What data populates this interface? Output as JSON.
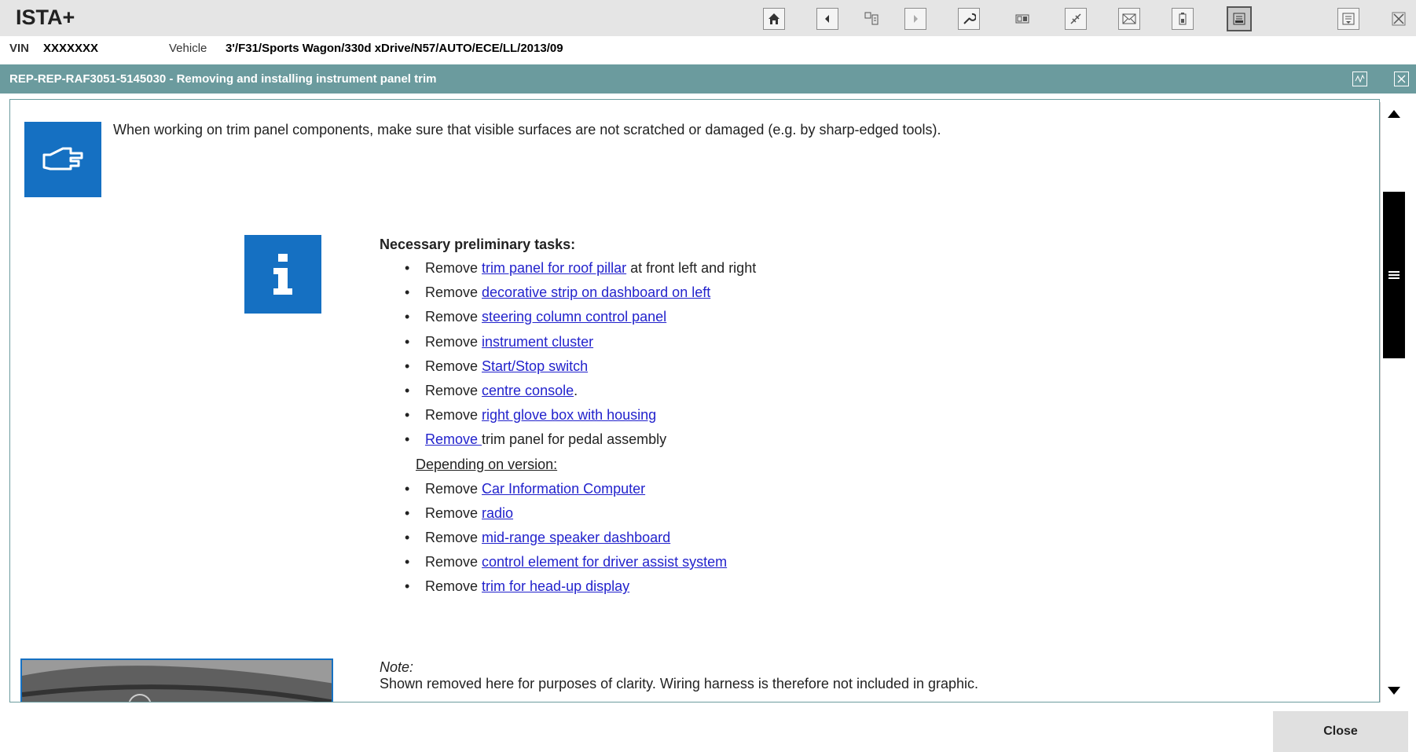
{
  "app": {
    "title": "ISTA+"
  },
  "vehicle": {
    "vin_label": "VIN",
    "vin": "XXXXXXX",
    "vehicle_label": "Vehicle",
    "vehicle": "3'/F31/Sports Wagon/330d xDrive/N57/AUTO/ECE/LL/2013/09"
  },
  "toolbar": {
    "icons": [
      "home-icon",
      "back-icon",
      "tree-icon",
      "forward-icon",
      "wrench-icon",
      "measure-icon",
      "connection-icon",
      "message-icon",
      "battery-icon",
      "document-view-icon",
      "menu-icon",
      "close-icon"
    ]
  },
  "document": {
    "title": "REP-REP-RAF3051-5145030 - Removing and installing instrument panel trim",
    "warning": "When working on trim panel components, make sure that visible surfaces are not scratched or damaged (e.g. by sharp-edged tools).",
    "tasks_heading": "Necessary preliminary tasks:",
    "tasks": [
      {
        "prefix": "Remove ",
        "link": "trim panel for roof pillar",
        "suffix": " at front left and right"
      },
      {
        "prefix": "Remove ",
        "link": "decorative strip on dashboard on left",
        "suffix": ""
      },
      {
        "prefix": "Remove ",
        "link": "steering column control panel",
        "suffix": ""
      },
      {
        "prefix": "Remove ",
        "link": "instrument cluster",
        "suffix": ""
      },
      {
        "prefix": "Remove ",
        "link": "Start/Stop switch",
        "suffix": ""
      },
      {
        "prefix": "Remove ",
        "link": "centre console",
        "suffix": "."
      },
      {
        "prefix": "Remove ",
        "link": "right glove box with housing",
        "suffix": ""
      },
      {
        "prefix": "",
        "link": "Remove ",
        "suffix": "trim panel for pedal assembly"
      }
    ],
    "version_heading": "Depending on version:",
    "version_tasks": [
      {
        "prefix": "Remove ",
        "link": "Car Information Computer",
        "suffix": ""
      },
      {
        "prefix": "Remove ",
        "link": "radio",
        "suffix": ""
      },
      {
        "prefix": "Remove ",
        "link": "mid-range speaker dashboard",
        "suffix": ""
      },
      {
        "prefix": "Remove ",
        "link": "control element for driver assist system",
        "suffix": ""
      },
      {
        "prefix": "Remove ",
        "link": "trim for head-up display",
        "suffix": ""
      }
    ],
    "note_label": "Note:",
    "note_text": "Shown removed here for purposes of clarity. Wiring harness is therefore not included in graphic."
  },
  "footer": {
    "close_label": "Close"
  },
  "colors": {
    "header": "#6b9b9e",
    "icon_blue": "#1570c2",
    "link": "#2222cc",
    "toolbar": "#e5e5e5"
  }
}
